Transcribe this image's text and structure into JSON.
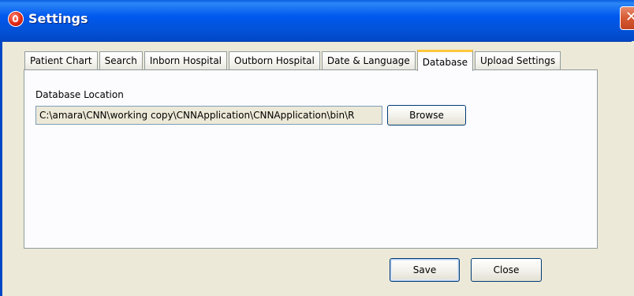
{
  "window": {
    "title": "Settings",
    "close_glyph": "✕"
  },
  "tabs": [
    {
      "label": "Patient Chart",
      "selected": false
    },
    {
      "label": "Search",
      "selected": false
    },
    {
      "label": "Inborn Hospital",
      "selected": false
    },
    {
      "label": "Outborn Hospital",
      "selected": false
    },
    {
      "label": "Date & Language",
      "selected": false
    },
    {
      "label": "Database",
      "selected": true
    },
    {
      "label": "Upload Settings",
      "selected": false
    }
  ],
  "database": {
    "label": "Database Location",
    "path_value": "C:\\amara\\CNN\\working copy\\CNNApplication\\CNNApplication\\bin\\R",
    "browse_label": "Browse"
  },
  "footer": {
    "save_label": "Save",
    "close_label": "Close"
  },
  "colors": {
    "titlebar": "#0058ee",
    "dialog_bg": "#ece9d8",
    "tab_highlight": "#ffc83c",
    "close_button": "#d65a34"
  }
}
